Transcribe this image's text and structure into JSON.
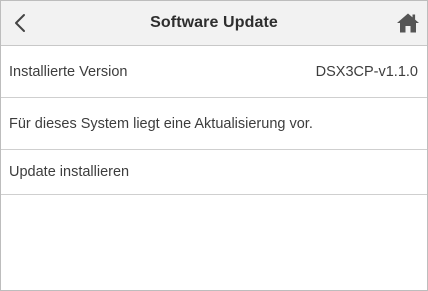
{
  "header": {
    "title": "Software Update",
    "back_icon": "chevron-left-icon",
    "home_icon": "home-icon"
  },
  "rows": [
    {
      "label": "Installierte Version",
      "value": "DSX3CP-v1.1.0"
    },
    {
      "label": "Für dieses System liegt eine Aktualisierung vor."
    },
    {
      "label": "Update installieren"
    }
  ],
  "colors": {
    "header_bg": "#f2f2f2",
    "divider": "#cfcfcf",
    "text": "#3d3d3d"
  }
}
